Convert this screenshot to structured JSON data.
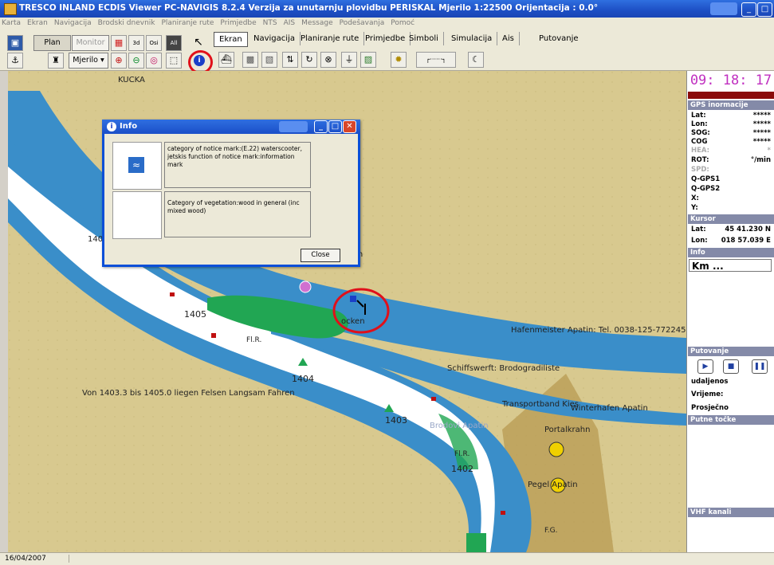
{
  "window": {
    "title": "TRESCO INLAND ECDIS Viewer PC-NAVIGIS 8.2.4  Verzija za unutarnju plovidbu  PERISKAL          Mjerilo 1:22500 Orijentacija :   0.0°"
  },
  "menu": [
    "Karta",
    "Ekran",
    "Navigacija",
    "Brodski dnevnik",
    "Planiranje rute",
    "Primjedbe",
    "NTS",
    "AIS",
    "Message",
    "Podešavanja",
    "Pomoć"
  ],
  "toolbar": {
    "plan": "Plan",
    "monitor": "Monitor",
    "mjerilo": "Mjerilo",
    "btn_3d": "3d",
    "btn_osi": "Osi",
    "btn_all": "All",
    "tabs": [
      "Ekran",
      "Navigacija",
      "Planiranje rute",
      "Primjedbe",
      "Simboli",
      "Simulacija",
      "Ais",
      "Putovanje"
    ]
  },
  "map": {
    "labels": {
      "kucka": "KUCKA",
      "km1405": "1405",
      "km1404": "1404",
      "km1403": "1403",
      "km1402": "1402",
      "km140x": "140",
      "fir1": "Fl.R.",
      "fir2": "Fl.R.",
      "fir3": "Fl.R.",
      "fg": "F.G.",
      "hafen": "Hafenmeister Apatin: Tel. 0038-125-772245",
      "schiff": "Schiffswerft: Brodogradiliste",
      "transport": "Transportband Kies",
      "winter": "Winterhafen Apatin",
      "portal": "Portalkrahn",
      "felsen": "Von 1403.3 bis 1405.0 liegen Felsen Langsam Fahren",
      "pegel": "Pegel Apatin",
      "brodovi": "Brodovi Apatin",
      "ocken": "ocken",
      "atin": "atin"
    }
  },
  "dialog": {
    "title": "Info",
    "row1_text": "category of notice mark:(E.22) waterscooter, jetskis function of notice mark:information mark",
    "row2_text": "Category of vegetation:wood in general (inc mixed wood)",
    "close": "Close"
  },
  "panel": {
    "clock": "09: 18: 17",
    "gps_header": "GPS inormacije",
    "lat": "Lat:",
    "lat_val": "*****",
    "lon": "Lon:",
    "lon_val": "*****",
    "sog": "SOG:",
    "sog_val": "*****",
    "cog": "COG",
    "cog_val": "*****",
    "hea": "HEA:",
    "hea_val": "*",
    "rot": "ROT:",
    "rot_val": "°/min",
    "spd": "SPD:",
    "qgps1": "Q-GPS1",
    "qgps2": "Q-GPS2",
    "x": "X:",
    "y": "Y:",
    "kursor_header": "Kursor",
    "k_lat": "Lat:",
    "k_lat_val": "45 41.230 N",
    "k_lon": "Lon:",
    "k_lon_val": "018 57.039 E",
    "info_header": "Info",
    "km": "Km ...",
    "putovanje_header": "Putovanje",
    "udaljenost": "udaljenos",
    "vrijeme": "Vrijeme:",
    "prosjecno": "Prosječno",
    "putne_header": "Putne točke",
    "vhf_header": "VHF kanali"
  },
  "status": {
    "date": "16/04/2007"
  },
  "colors": {
    "land": "#d8c98f",
    "water_deep": "#3a8ec9",
    "fairway": "#ffffff",
    "wood": "#21a653",
    "port_area": "#b89a52",
    "highlight": "#e0101a"
  }
}
